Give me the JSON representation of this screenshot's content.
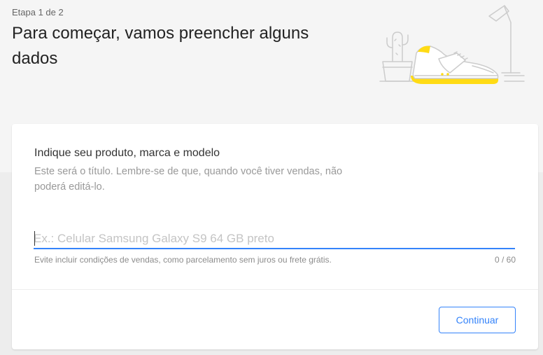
{
  "header": {
    "step_label": "Etapa 1 de 2",
    "title": "Para começar, vamos preencher alguns dados"
  },
  "illustration": {
    "icon": "sneaker-illustration",
    "colors": {
      "accent": "#ffdb15",
      "line": "#cccccc"
    }
  },
  "form": {
    "heading": "Indique seu produto, marca e modelo",
    "description": "Este será o título. Lembre-se de que, quando você tiver vendas, não poderá editá-lo.",
    "input_value": "",
    "input_placeholder": "Ex.: Celular Samsung Galaxy S9 64 GB preto",
    "helper_text": "Evite incluir condições de vendas, como parcelamento sem juros ou frete grátis.",
    "char_counter": "0 / 60",
    "max_length": "60"
  },
  "footer": {
    "continue_label": "Continuar"
  },
  "colors": {
    "accent_blue": "#3483fa",
    "page_background": "#ededed",
    "header_background": "#f5f5f5"
  }
}
